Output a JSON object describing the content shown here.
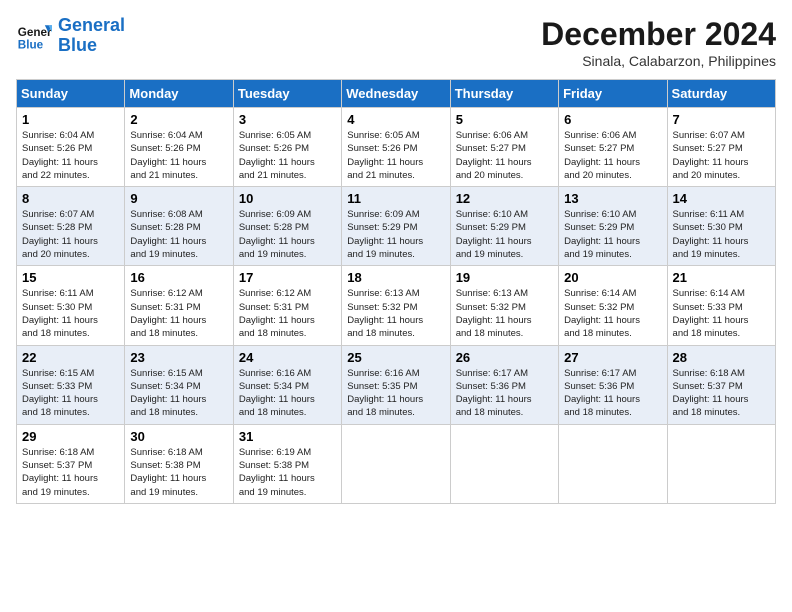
{
  "header": {
    "logo_line1": "General",
    "logo_line2": "Blue",
    "month_title": "December 2024",
    "subtitle": "Sinala, Calabarzon, Philippines"
  },
  "weekdays": [
    "Sunday",
    "Monday",
    "Tuesday",
    "Wednesday",
    "Thursday",
    "Friday",
    "Saturday"
  ],
  "weeks": [
    [
      {
        "day": "1",
        "info": "Sunrise: 6:04 AM\nSunset: 5:26 PM\nDaylight: 11 hours\nand 22 minutes."
      },
      {
        "day": "2",
        "info": "Sunrise: 6:04 AM\nSunset: 5:26 PM\nDaylight: 11 hours\nand 21 minutes."
      },
      {
        "day": "3",
        "info": "Sunrise: 6:05 AM\nSunset: 5:26 PM\nDaylight: 11 hours\nand 21 minutes."
      },
      {
        "day": "4",
        "info": "Sunrise: 6:05 AM\nSunset: 5:26 PM\nDaylight: 11 hours\nand 21 minutes."
      },
      {
        "day": "5",
        "info": "Sunrise: 6:06 AM\nSunset: 5:27 PM\nDaylight: 11 hours\nand 20 minutes."
      },
      {
        "day": "6",
        "info": "Sunrise: 6:06 AM\nSunset: 5:27 PM\nDaylight: 11 hours\nand 20 minutes."
      },
      {
        "day": "7",
        "info": "Sunrise: 6:07 AM\nSunset: 5:27 PM\nDaylight: 11 hours\nand 20 minutes."
      }
    ],
    [
      {
        "day": "8",
        "info": "Sunrise: 6:07 AM\nSunset: 5:28 PM\nDaylight: 11 hours\nand 20 minutes."
      },
      {
        "day": "9",
        "info": "Sunrise: 6:08 AM\nSunset: 5:28 PM\nDaylight: 11 hours\nand 19 minutes."
      },
      {
        "day": "10",
        "info": "Sunrise: 6:09 AM\nSunset: 5:28 PM\nDaylight: 11 hours\nand 19 minutes."
      },
      {
        "day": "11",
        "info": "Sunrise: 6:09 AM\nSunset: 5:29 PM\nDaylight: 11 hours\nand 19 minutes."
      },
      {
        "day": "12",
        "info": "Sunrise: 6:10 AM\nSunset: 5:29 PM\nDaylight: 11 hours\nand 19 minutes."
      },
      {
        "day": "13",
        "info": "Sunrise: 6:10 AM\nSunset: 5:29 PM\nDaylight: 11 hours\nand 19 minutes."
      },
      {
        "day": "14",
        "info": "Sunrise: 6:11 AM\nSunset: 5:30 PM\nDaylight: 11 hours\nand 19 minutes."
      }
    ],
    [
      {
        "day": "15",
        "info": "Sunrise: 6:11 AM\nSunset: 5:30 PM\nDaylight: 11 hours\nand 18 minutes."
      },
      {
        "day": "16",
        "info": "Sunrise: 6:12 AM\nSunset: 5:31 PM\nDaylight: 11 hours\nand 18 minutes."
      },
      {
        "day": "17",
        "info": "Sunrise: 6:12 AM\nSunset: 5:31 PM\nDaylight: 11 hours\nand 18 minutes."
      },
      {
        "day": "18",
        "info": "Sunrise: 6:13 AM\nSunset: 5:32 PM\nDaylight: 11 hours\nand 18 minutes."
      },
      {
        "day": "19",
        "info": "Sunrise: 6:13 AM\nSunset: 5:32 PM\nDaylight: 11 hours\nand 18 minutes."
      },
      {
        "day": "20",
        "info": "Sunrise: 6:14 AM\nSunset: 5:32 PM\nDaylight: 11 hours\nand 18 minutes."
      },
      {
        "day": "21",
        "info": "Sunrise: 6:14 AM\nSunset: 5:33 PM\nDaylight: 11 hours\nand 18 minutes."
      }
    ],
    [
      {
        "day": "22",
        "info": "Sunrise: 6:15 AM\nSunset: 5:33 PM\nDaylight: 11 hours\nand 18 minutes."
      },
      {
        "day": "23",
        "info": "Sunrise: 6:15 AM\nSunset: 5:34 PM\nDaylight: 11 hours\nand 18 minutes."
      },
      {
        "day": "24",
        "info": "Sunrise: 6:16 AM\nSunset: 5:34 PM\nDaylight: 11 hours\nand 18 minutes."
      },
      {
        "day": "25",
        "info": "Sunrise: 6:16 AM\nSunset: 5:35 PM\nDaylight: 11 hours\nand 18 minutes."
      },
      {
        "day": "26",
        "info": "Sunrise: 6:17 AM\nSunset: 5:36 PM\nDaylight: 11 hours\nand 18 minutes."
      },
      {
        "day": "27",
        "info": "Sunrise: 6:17 AM\nSunset: 5:36 PM\nDaylight: 11 hours\nand 18 minutes."
      },
      {
        "day": "28",
        "info": "Sunrise: 6:18 AM\nSunset: 5:37 PM\nDaylight: 11 hours\nand 18 minutes."
      }
    ],
    [
      {
        "day": "29",
        "info": "Sunrise: 6:18 AM\nSunset: 5:37 PM\nDaylight: 11 hours\nand 19 minutes."
      },
      {
        "day": "30",
        "info": "Sunrise: 6:18 AM\nSunset: 5:38 PM\nDaylight: 11 hours\nand 19 minutes."
      },
      {
        "day": "31",
        "info": "Sunrise: 6:19 AM\nSunset: 5:38 PM\nDaylight: 11 hours\nand 19 minutes."
      },
      null,
      null,
      null,
      null
    ]
  ]
}
